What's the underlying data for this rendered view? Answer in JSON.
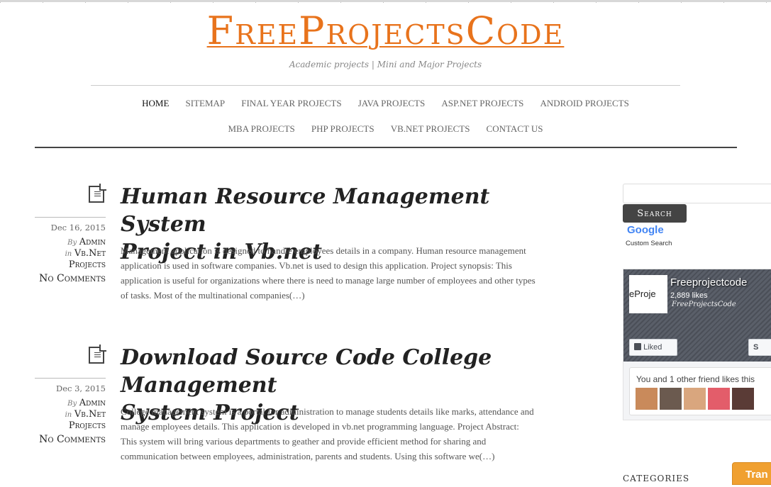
{
  "site": {
    "title": "FreeProjectsCode",
    "tagline": "Academic projects | Mini and Major Projects"
  },
  "nav": {
    "row1": [
      "HOME",
      "SITEMAP",
      "FINAL YEAR PROJECTS",
      "JAVA PROJECTS",
      "ASP.NET PROJECTS",
      "ANDROID PROJECTS"
    ],
    "row2": [
      "MBA PROJECTS",
      "PHP PROJECTS",
      "VB.NET PROJECTS",
      "CONTACT US"
    ],
    "active": "HOME"
  },
  "posts": [
    {
      "date": "Dec 16, 2015",
      "by_prefix": "By",
      "author": "Admin",
      "in_prefix": "in",
      "category_line1": "Vb.Net",
      "category_line2": "Projects",
      "comments": "No Comments",
      "title_line1": "Human Resource Management System",
      "title_line2": "Project in Vb.net",
      "excerpt": "Management application is designed to handle employees details in a company. Human resource management application is used in software companies. Vb.net is used to design this application. Project synopsis: This application is useful for organizations where there is need to manage large number of employees and other types of tasks. Most of the multinational companies(…)"
    },
    {
      "date": "Dec 3, 2015",
      "by_prefix": "By",
      "author": "Admin",
      "in_prefix": "in",
      "category_line1": "Vb.Net",
      "category_line2": "Projects",
      "comments": "No Comments",
      "title_line1": "Download Source Code College Management",
      "title_line2": "System Project",
      "excerpt": "College management system is a portal for administration to manage students details like marks, attendance and manage employees details. This application is developed in vb.net programming language. Project Abstract: This system will bring various departments to geather and provide efficient method for sharing and communication between employees, administration, parents and students. Using this software we(…)"
    }
  ],
  "sidebar": {
    "search_button": "Search",
    "google_label": "Google",
    "custom_search": "Custom Search",
    "fb": {
      "page_name": "Freeprojectcode",
      "likes": "2,889 likes",
      "logo_text": "eProje",
      "watermark": "FreeProjectsCode",
      "liked_label": "Liked",
      "share_label": "S",
      "friends_text": "You and 1 other friend likes this"
    },
    "categories_heading": "CATEGORIES",
    "translate_label": "Tran"
  },
  "colors": {
    "brand_orange": "#e8731c",
    "nav_rule": "#444444",
    "translate_bg": "#f0a030"
  }
}
